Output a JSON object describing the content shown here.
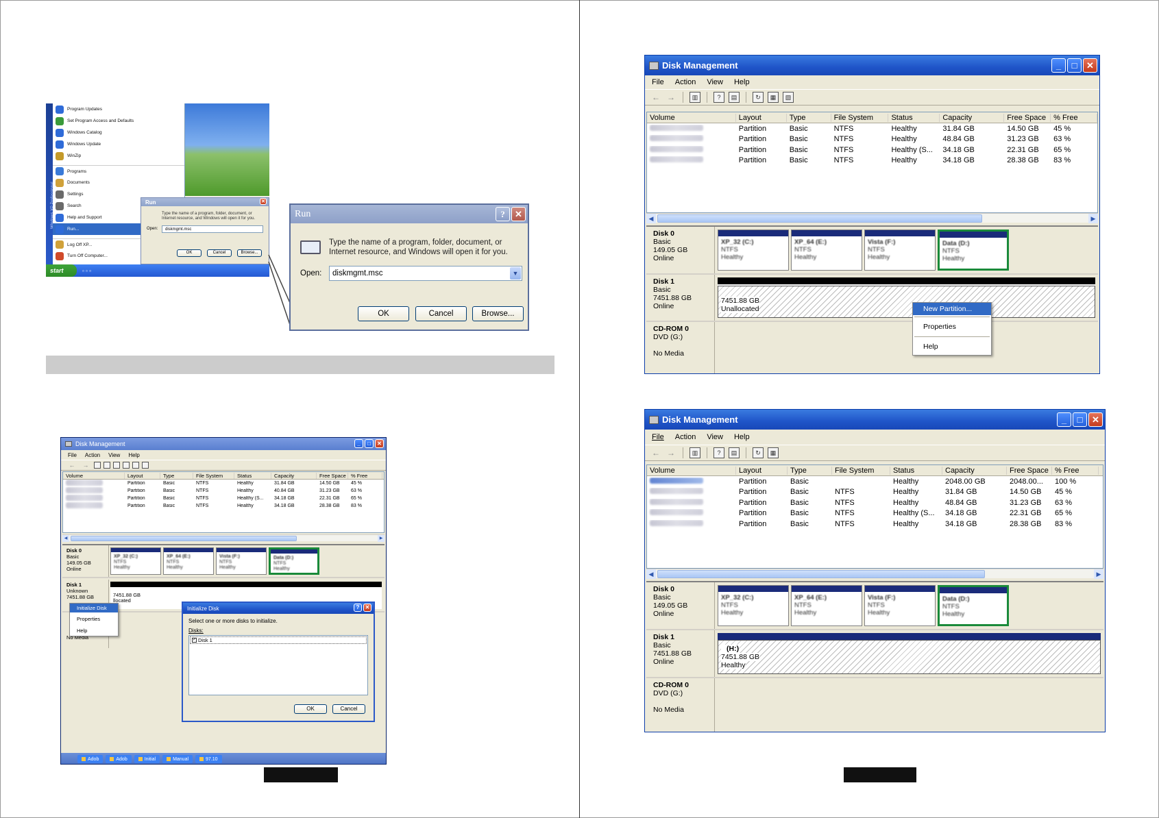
{
  "colors": {
    "xp_blue": "#1f54c8",
    "selection": "#316ac5",
    "partition_header": "#1a2b7a",
    "selected_border": "#1a8a3a"
  },
  "start_menu": {
    "items": [
      "Program Updates",
      "Set Program Access and Defaults",
      "Windows Catalog",
      "Windows Update",
      "WinZip",
      "Programs",
      "Documents",
      "Settings",
      "Search",
      "Help and Support",
      "Run...",
      "Log Off XP...",
      "Turn Off Computer..."
    ],
    "side_label": "Windows XP Professional",
    "start_label": "start"
  },
  "run_small": {
    "title": "Run",
    "text": "Type the name of a program, folder, document, or Internet resource, and Windows will open it for you.",
    "open_label": "Open:",
    "value": "diskmgmt.msc",
    "ok": "OK",
    "cancel": "Cancel",
    "browse": "Browse..."
  },
  "run_large": {
    "title": "Run",
    "help_icon": "?",
    "text": "Type the name of a program, folder, document, or Internet resource, and Windows will open it for you.",
    "open_label": "Open:",
    "value": "diskmgmt.msc",
    "ok": "OK",
    "cancel": "Cancel",
    "browse": "Browse..."
  },
  "dm_common": {
    "title": "Disk Management",
    "menu": [
      "File",
      "Action",
      "View",
      "Help"
    ],
    "columns": [
      "Volume",
      "Layout",
      "Type",
      "File System",
      "Status",
      "Capacity",
      "Free Space",
      "% Free"
    ],
    "rows": [
      {
        "layout": "Partition",
        "type": "Basic",
        "fs": "NTFS",
        "status": "Healthy",
        "capacity": "31.84 GB",
        "free": "14.50 GB",
        "pct": "45 %"
      },
      {
        "layout": "Partition",
        "type": "Basic",
        "fs": "NTFS",
        "status": "Healthy",
        "capacity": "48.84 GB",
        "free": "31.23 GB",
        "pct": "63 %"
      },
      {
        "layout": "Partition",
        "type": "Basic",
        "fs": "NTFS",
        "status": "Healthy (S...",
        "capacity": "34.18 GB",
        "free": "22.31 GB",
        "pct": "65 %"
      },
      {
        "layout": "Partition",
        "type": "Basic",
        "fs": "NTFS",
        "status": "Healthy",
        "capacity": "34.18 GB",
        "free": "28.38 GB",
        "pct": "83 %"
      }
    ],
    "disk0": {
      "name": "Disk 0",
      "type": "Basic",
      "size": "149.05 GB",
      "state": "Online",
      "parts": [
        "XP_32 (C:)",
        "XP_64 (E:)",
        "Vista (F:)",
        "Data (D:)"
      ],
      "part_detail": "NTFS",
      "part_status": "Healthy"
    },
    "cdrom": {
      "name": "CD-ROM 0",
      "type": "DVD (G:)",
      "state": "No Media"
    }
  },
  "dm_left": {
    "rows": [
      {
        "layout": "Partition",
        "type": "Basic",
        "fs": "NTFS",
        "status": "Healthy",
        "capacity": "31.84 GB",
        "free": "14.50 GB",
        "pct": "45 %"
      },
      {
        "layout": "Partition",
        "type": "Basic",
        "fs": "NTFS",
        "status": "Healthy",
        "capacity": "40.84 GB",
        "free": "31.23 GB",
        "pct": "63 %"
      },
      {
        "layout": "Partition",
        "type": "Basic",
        "fs": "NTFS",
        "status": "Healthy (S...",
        "capacity": "34.18 GB",
        "free": "22.31 GB",
        "pct": "65 %"
      },
      {
        "layout": "Partition",
        "type": "Basic",
        "fs": "NTFS",
        "status": "Healthy",
        "capacity": "34.18 GB",
        "free": "28.38 GB",
        "pct": "83 %"
      }
    ],
    "disk1": {
      "name": "Disk 1",
      "type": "Unknown",
      "size": "7451.88 GB",
      "unalloc_size": "7451.88 GB",
      "unalloc_label": "llocated"
    },
    "menu": [
      "Initialize Disk",
      "Properties",
      "Help"
    ],
    "init_dialog": {
      "title": "Initialize Disk",
      "prompt": "Select one or more disks to initialize.",
      "disks_label": "Disks:",
      "disk_item": "Disk 1",
      "ok": "OK",
      "cancel": "Cancel"
    },
    "taskbar": [
      "Adob",
      "Adob",
      "Initial",
      "Manual",
      "97.10"
    ]
  },
  "dm_top": {
    "disk1": {
      "name": "Disk 1",
      "type": "Basic",
      "size": "7451.88 GB",
      "state": "Online",
      "unalloc_size": "7451.88 GB",
      "unalloc_label": "Unallocated"
    },
    "menu": [
      "New Partition...",
      "Properties",
      "Help"
    ]
  },
  "dm_bottom": {
    "new_row": {
      "layout": "Partition",
      "type": "Basic",
      "fs": "",
      "status": "Healthy",
      "capacity": "2048.00 GB",
      "free": "2048.00...",
      "pct": "100 %"
    },
    "disk1": {
      "name": "Disk 1",
      "type": "Basic",
      "size": "7451.88 GB",
      "state": "Online",
      "vol_label": "(H:)",
      "vol_size": "7451.88 GB",
      "vol_status": "Healthy"
    }
  }
}
